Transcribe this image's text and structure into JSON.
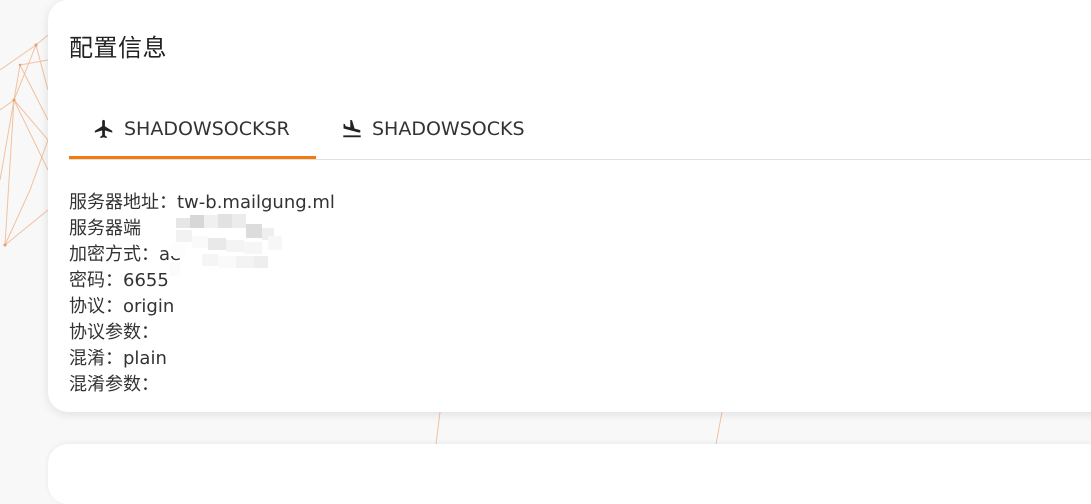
{
  "page": {
    "title": "配置信息"
  },
  "tabs": [
    {
      "label": "SHADOWSOCKSR",
      "icon": "airplane-takeoff-icon",
      "active": true
    },
    {
      "label": "SHADOWSOCKS",
      "icon": "airplane-landing-icon",
      "active": false
    }
  ],
  "info": [
    {
      "label": "服务器地址：",
      "value": "tw-b.mailgung.ml"
    },
    {
      "label": "服务器端",
      "value": ""
    },
    {
      "label": "加密方式：",
      "value": "ae"
    },
    {
      "label": "密码：",
      "value": "6655"
    },
    {
      "label": "协议：",
      "value": "origin"
    },
    {
      "label": "协议参数：",
      "value": ""
    },
    {
      "label": "混淆：",
      "value": "plain"
    },
    {
      "label": "混淆参数：",
      "value": ""
    }
  ],
  "colors": {
    "accent": "#f07c10",
    "text": "#333333",
    "card": "#ffffff",
    "background": "#f8f8f8"
  }
}
